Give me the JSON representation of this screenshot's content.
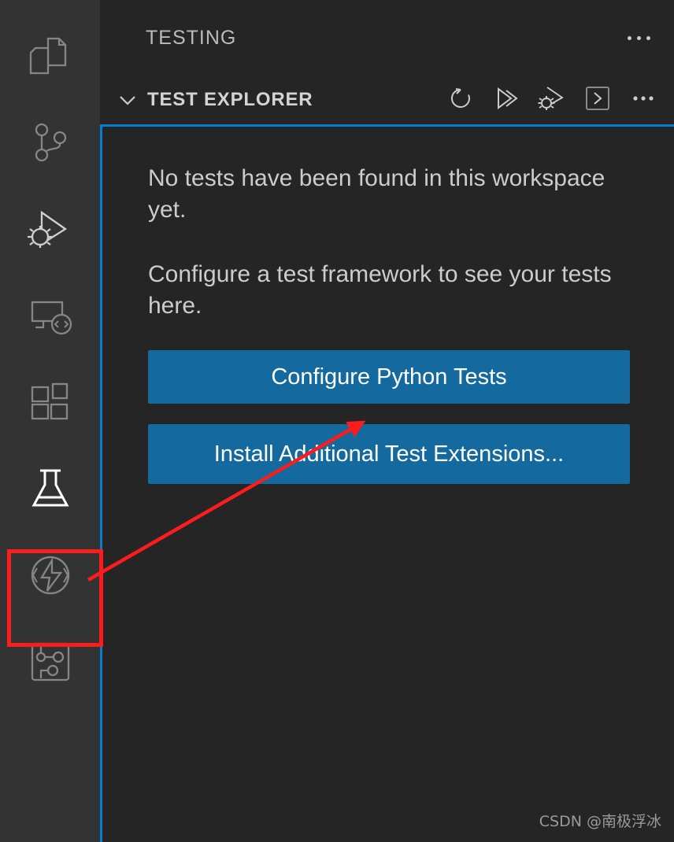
{
  "window": {
    "theme": "dark",
    "colors": {
      "activity_bar_bg": "#333333",
      "sidebar_bg": "#252526",
      "focus_border": "#007fd4",
      "button_bg": "#14699f",
      "button_fg": "#ffffff",
      "text_fg": "#cccccc",
      "annotation_red": "#fb1d1d"
    }
  },
  "activity_bar": {
    "items": [
      {
        "id": "explorer",
        "icon": "files-icon",
        "label": "Explorer",
        "active": false
      },
      {
        "id": "source-control",
        "icon": "source-control-icon",
        "label": "Source Control",
        "active": false
      },
      {
        "id": "run-and-debug",
        "icon": "run-and-debug-icon",
        "label": "Run and Debug",
        "active": false
      },
      {
        "id": "remote-explorer",
        "icon": "remote-explorer-icon",
        "label": "Remote Explorer",
        "active": false
      },
      {
        "id": "extensions",
        "icon": "extensions-icon",
        "label": "Extensions",
        "active": false
      },
      {
        "id": "testing",
        "icon": "beaker-icon",
        "label": "Testing",
        "active": true
      },
      {
        "id": "thunder-client",
        "icon": "thunder-client-icon",
        "label": "Thunder Client",
        "active": false
      },
      {
        "id": "platformio",
        "icon": "circuit-board-icon",
        "label": "PlatformIO",
        "active": false
      }
    ]
  },
  "sidebar": {
    "title": "TESTING",
    "more_actions_label": "...",
    "section": {
      "title": "TEST EXPLORER",
      "expanded": true,
      "chevron_icon": "chevron-down-icon",
      "toolbar": [
        {
          "id": "refresh-tests",
          "icon": "refresh-icon",
          "label": "Refresh Tests"
        },
        {
          "id": "run-all-tests",
          "icon": "run-all-icon",
          "label": "Run All Tests"
        },
        {
          "id": "debug-all-tests",
          "icon": "debug-all-icon",
          "label": "Debug All Tests"
        },
        {
          "id": "show-output",
          "icon": "terminal-icon",
          "label": "Show Output"
        },
        {
          "id": "views-and-more-actions",
          "icon": "ellipsis-icon",
          "label": "Views and More Actions..."
        }
      ]
    }
  },
  "welcome": {
    "paragraph_1": "No tests have been found in this workspace yet.",
    "paragraph_2": "Configure a test framework to see your tests here.",
    "buttons": [
      {
        "id": "configure-python-tests",
        "label": "Configure Python Tests"
      },
      {
        "id": "install-additional-test-extensions",
        "label": "Install Additional Test Extensions..."
      }
    ]
  },
  "annotations": {
    "highlight_target": "testing",
    "arrow_points_to": "configure-python-tests"
  },
  "watermark": {
    "text": "CSDN @南极浮冰"
  }
}
